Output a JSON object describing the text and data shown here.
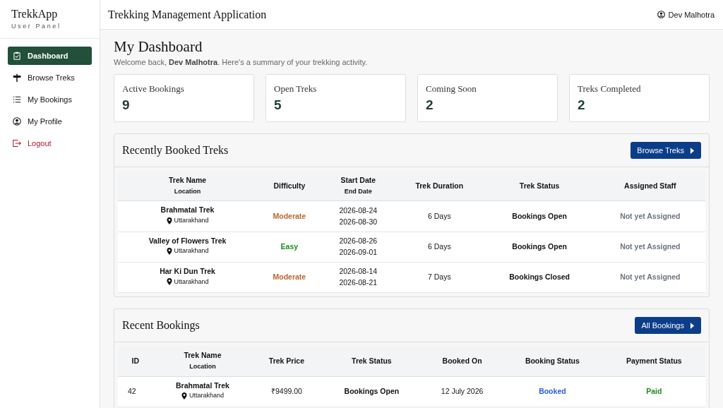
{
  "brand": {
    "title": "TrekkApp",
    "subtitle": "User Panel"
  },
  "nav": [
    {
      "label": "Dashboard",
      "selected": true,
      "kind": "normal"
    },
    {
      "label": "Browse Treks",
      "selected": false,
      "kind": "normal"
    },
    {
      "label": "My Bookings",
      "selected": false,
      "kind": "normal"
    },
    {
      "label": "My Profile",
      "selected": false,
      "kind": "normal"
    },
    {
      "label": "Logout",
      "selected": false,
      "kind": "danger"
    }
  ],
  "header": {
    "title": "Trekking Management Application",
    "user": "Dev Malhotra"
  },
  "page": {
    "title": "My Dashboard",
    "welcome": "Welcome back, **Dev Malhotra**. Here's a summary of your trekking activity."
  },
  "stats": [
    {
      "label": "Active Bookings",
      "value": "9"
    },
    {
      "label": "Open Treks",
      "value": "5"
    },
    {
      "label": "Coming Soon",
      "value": "2"
    },
    {
      "label": "Treks Completed",
      "value": "2"
    }
  ],
  "recent_treks": {
    "title": "Recently Booked Treks",
    "button": "Browse Treks",
    "columns": [
      [
        "Trek Name",
        "Location"
      ],
      [
        "Difficulty"
      ],
      [
        "Start Date",
        "End Date"
      ],
      [
        "Trek Duration"
      ],
      [
        "Trek Status"
      ],
      [
        "Assigned Staff"
      ]
    ],
    "rows": [
      {
        "name": "Brahmatal Trek",
        "location": "Uttarakhand",
        "difficulty": {
          "text": "Moderate",
          "color": "#b8672e"
        },
        "start": "2026-08-24",
        "end": "2026-08-30",
        "duration": "6 Days",
        "status": "Bookings Open",
        "staff": "Not yet Assigned"
      },
      {
        "name": "Valley of Flowers Trek",
        "location": "Uttarakhand",
        "difficulty": {
          "text": "Easy",
          "color": "#1e8a1e"
        },
        "start": "2026-08-26",
        "end": "2026-09-01",
        "duration": "6 Days",
        "status": "Bookings Open",
        "staff": "Not yet Assigned"
      },
      {
        "name": "Har Ki Dun Trek",
        "location": "Uttarakhand",
        "difficulty": {
          "text": "Moderate",
          "color": "#b8672e"
        },
        "start": "2026-08-14",
        "end": "2026-08-21",
        "duration": "7 Days",
        "status": "Bookings Closed",
        "staff": "Not yet Assigned"
      }
    ]
  },
  "recent_bookings": {
    "title": "Recent Bookings",
    "button": "All Bookings",
    "columns": [
      [
        "ID"
      ],
      [
        "Trek Name",
        "Location"
      ],
      [
        "Trek Price"
      ],
      [
        "Trek Status"
      ],
      [
        "Booked On"
      ],
      [
        "Booking Status"
      ],
      [
        "Payment Status"
      ]
    ],
    "rows": [
      {
        "id": "42",
        "name": "Brahmatal Trek",
        "location": "Uttarakhand",
        "price": "₹9499.00",
        "status": "Bookings Open",
        "booked_on": "12 July 2026",
        "booking_status": {
          "text": "Booked",
          "color": "#2a5bd7"
        },
        "payment_status": {
          "text": "Paid",
          "color": "#1e8a1e"
        }
      }
    ]
  }
}
